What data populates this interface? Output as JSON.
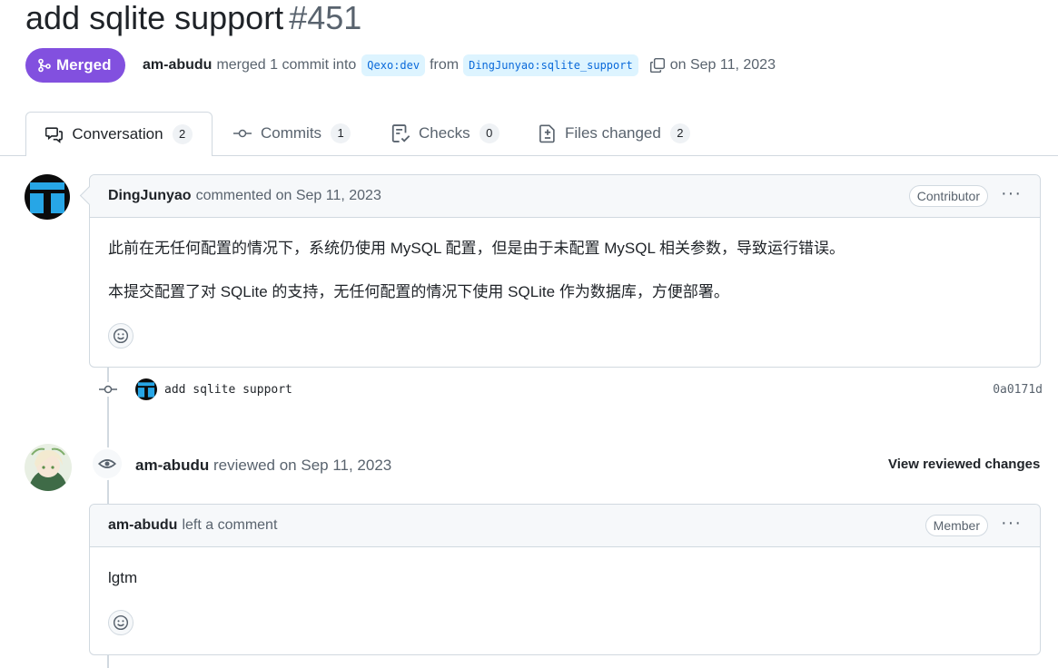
{
  "pr": {
    "title": "add sqlite support",
    "number": "#451",
    "state": "Merged",
    "author": "am-abudu",
    "merge_text": "merged 1 commit into",
    "base_branch": "Qexo:dev",
    "from_text": "from",
    "head_branch": "DingJunyao:sqlite_support",
    "date_text": "on Sep 11, 2023"
  },
  "tabs": [
    {
      "label": "Conversation",
      "count": "2"
    },
    {
      "label": "Commits",
      "count": "1"
    },
    {
      "label": "Checks",
      "count": "0"
    },
    {
      "label": "Files changed",
      "count": "2"
    }
  ],
  "comment1": {
    "author": "DingJunyao",
    "action": "commented on Sep 11, 2023",
    "role": "Contributor",
    "paragraphs": [
      "此前在无任何配置的情况下，系统仍使用 MySQL 配置，但是由于未配置 MySQL 相关参数，导致运行错误。",
      "本提交配置了对 SQLite 的支持，无任何配置的情况下使用 SQLite 作为数据库，方便部署。"
    ]
  },
  "commit": {
    "message": "add sqlite support",
    "sha": "0a0171d"
  },
  "review": {
    "author": "am-abudu",
    "action": "reviewed on Sep 11, 2023",
    "view_changes": "View reviewed changes"
  },
  "comment2": {
    "author": "am-abudu",
    "action": "left a comment",
    "role": "Member",
    "body": "lgtm"
  },
  "colors": {
    "merged": "#8250df",
    "link": "#0969da",
    "branch_bg": "#ddf4ff",
    "border": "#d1d9e0",
    "muted": "#59636e"
  }
}
